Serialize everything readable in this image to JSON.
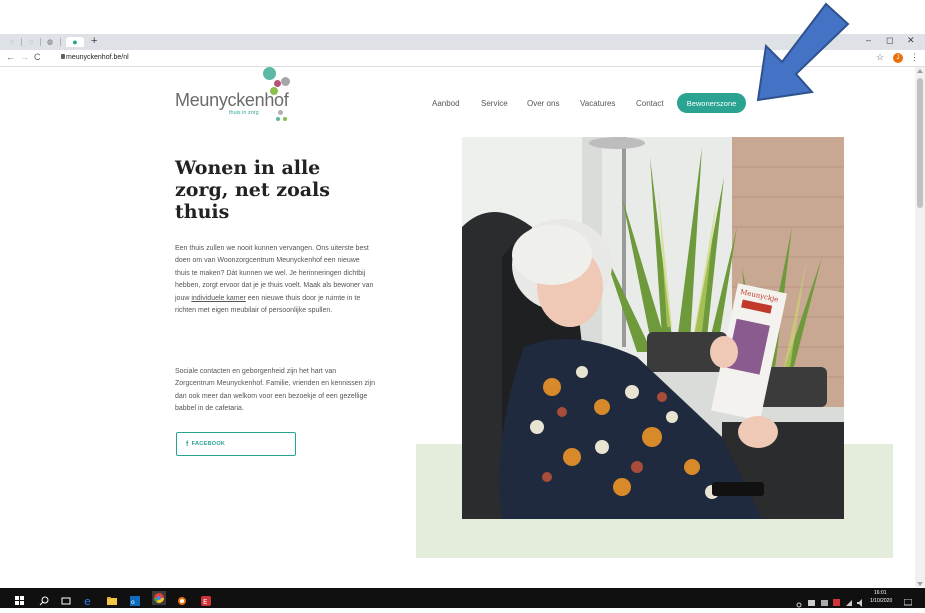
{
  "browser": {
    "url": "meunyckenhof.be/nl",
    "new_tab_label": "+",
    "window_controls": [
      "–",
      "◻",
      "✕"
    ],
    "profile_initial": "J",
    "accent_color": "#1a73e8"
  },
  "site": {
    "logo_text": "Meunyckenhof",
    "logo_sub": "thuis in zorg",
    "brand_color": "#2aa392",
    "nav": {
      "aanbod": "Aanbod",
      "service": "Service",
      "over_ons": "Over ons",
      "vacatures": "Vacatures",
      "contact": "Contact",
      "bewonerszone": "Bewonerszone"
    }
  },
  "hero": {
    "title": "Wonen in alle zorg, net zoals thuis",
    "p1_before": "Een thuis zullen we nooit kunnen vervangen. Ons uiterste best doen om van Woonzorgcentrum Meunyckenhof een nieuwe thuis te maken? Dát kunnen we wel. Je herinneringen dichtbij hebben, zorgt ervoor dat je je thuis voelt. Maak als bewoner van jouw ",
    "p1_link": "individuele kamer",
    "p1_after": " een nieuwe thuis door je ruimte in te richten met eigen meubilair of persoonlijke spullen.",
    "p2": "Sociale contacten en geborgenheid zijn het hart van Zorgcentrum Meunyckenhof. Familie, vrienden en kennissen zijn dan ook meer dan welkom voor een bezoekje of een gezellige babbel in de cafetaria.",
    "fb_icon": "f",
    "fb_label": "FACEBOOK",
    "magazine_title": "Meunyckje"
  },
  "taskbar": {
    "time": "16:01",
    "date": "1/10/2020"
  }
}
